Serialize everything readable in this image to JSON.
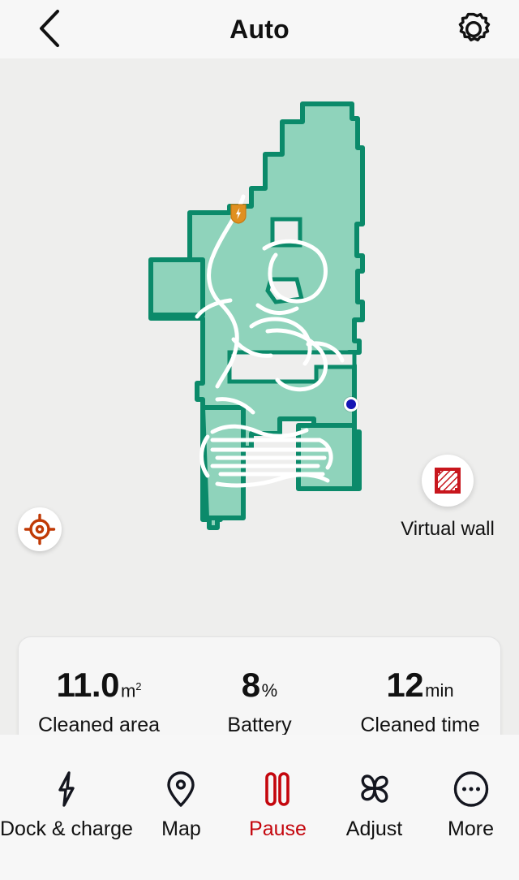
{
  "header": {
    "title": "Auto",
    "back_icon": "chevron-left-icon",
    "settings_icon": "gear-icon"
  },
  "map": {
    "dock_marker": {
      "icon": "charging-dock-badge-icon",
      "color": "#e09020"
    },
    "robot_marker": {
      "icon": "robot-position-dot-icon",
      "color": "#1515b4"
    },
    "fill_color": "#8fd3bb",
    "outline_color": "#0b8a6a",
    "path_color": "#ffffff",
    "background_color": "#eeeeed"
  },
  "locate_button": {
    "icon": "crosshair-target-icon",
    "color": "#c03a06"
  },
  "virtual_wall": {
    "label": "Virtual wall",
    "icon": "virtual-wall-hatched-square-icon",
    "color": "#c8161d"
  },
  "stats": [
    {
      "value": "11.0",
      "unit": "m",
      "unit_sup": "2",
      "label": "Cleaned area"
    },
    {
      "value": "8",
      "unit": "%",
      "unit_sup": "",
      "label": "Battery"
    },
    {
      "value": "12",
      "unit": "min",
      "unit_sup": "",
      "label": "Cleaned time"
    }
  ],
  "toolbar": [
    {
      "label": "Dock & charge",
      "icon": "lightning-bolt-icon",
      "accent": false
    },
    {
      "label": "Map",
      "icon": "map-pin-icon",
      "accent": false
    },
    {
      "label": "Pause",
      "icon": "pause-icon",
      "accent": true
    },
    {
      "label": "Adjust",
      "icon": "fan-blades-icon",
      "accent": false
    },
    {
      "label": "More",
      "icon": "ellipsis-circle-icon",
      "accent": false
    }
  ],
  "accent_color": "#c4060d"
}
